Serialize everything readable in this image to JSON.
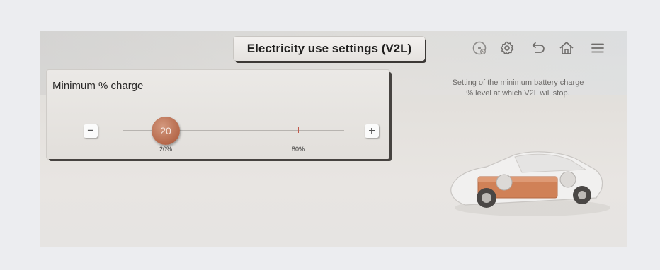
{
  "header": {
    "title": "Electricity use settings (V2L)",
    "icons": [
      "media-off-icon",
      "settings-gear-icon",
      "back-arrow-icon",
      "home-icon",
      "menu-icon"
    ]
  },
  "panel": {
    "title": "Minimum % charge",
    "minus_label": "−",
    "plus_label": "+",
    "slider": {
      "value": "20",
      "min_label": "20%",
      "marker_label": "80%",
      "value_fraction": 0.2,
      "marker_fraction": 0.8
    }
  },
  "info": {
    "line1": "Setting of the minimum battery charge",
    "line2": "% level at which V2L will stop."
  },
  "colors": {
    "accent": "#b5684a",
    "marker": "#c1584a",
    "battery": "#d08157"
  }
}
